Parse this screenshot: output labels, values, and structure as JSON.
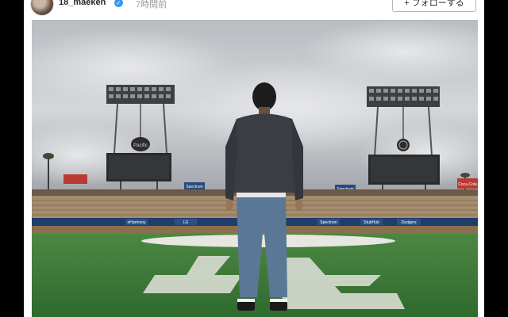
{
  "post": {
    "username": "18_maeken",
    "verified_glyph": "✓",
    "timestamp": "7時間前",
    "follow_label": "+ フォローする"
  },
  "photo": {
    "scoreboard_logo_left": "Pacific",
    "banner_left": "Spectrum",
    "banner_mid": "Spectrum",
    "banner_right_box": "Coca-Cola",
    "wall_ads": [
      "eHarmony",
      "LG",
      "Spectrum",
      "StubHub",
      "Dodgers"
    ]
  },
  "colors": {
    "verified": "#3897f0",
    "grass": "#3d7a3a",
    "sky": "#c5c8cc"
  },
  "icons": {
    "verified": "verified-badge-icon"
  }
}
